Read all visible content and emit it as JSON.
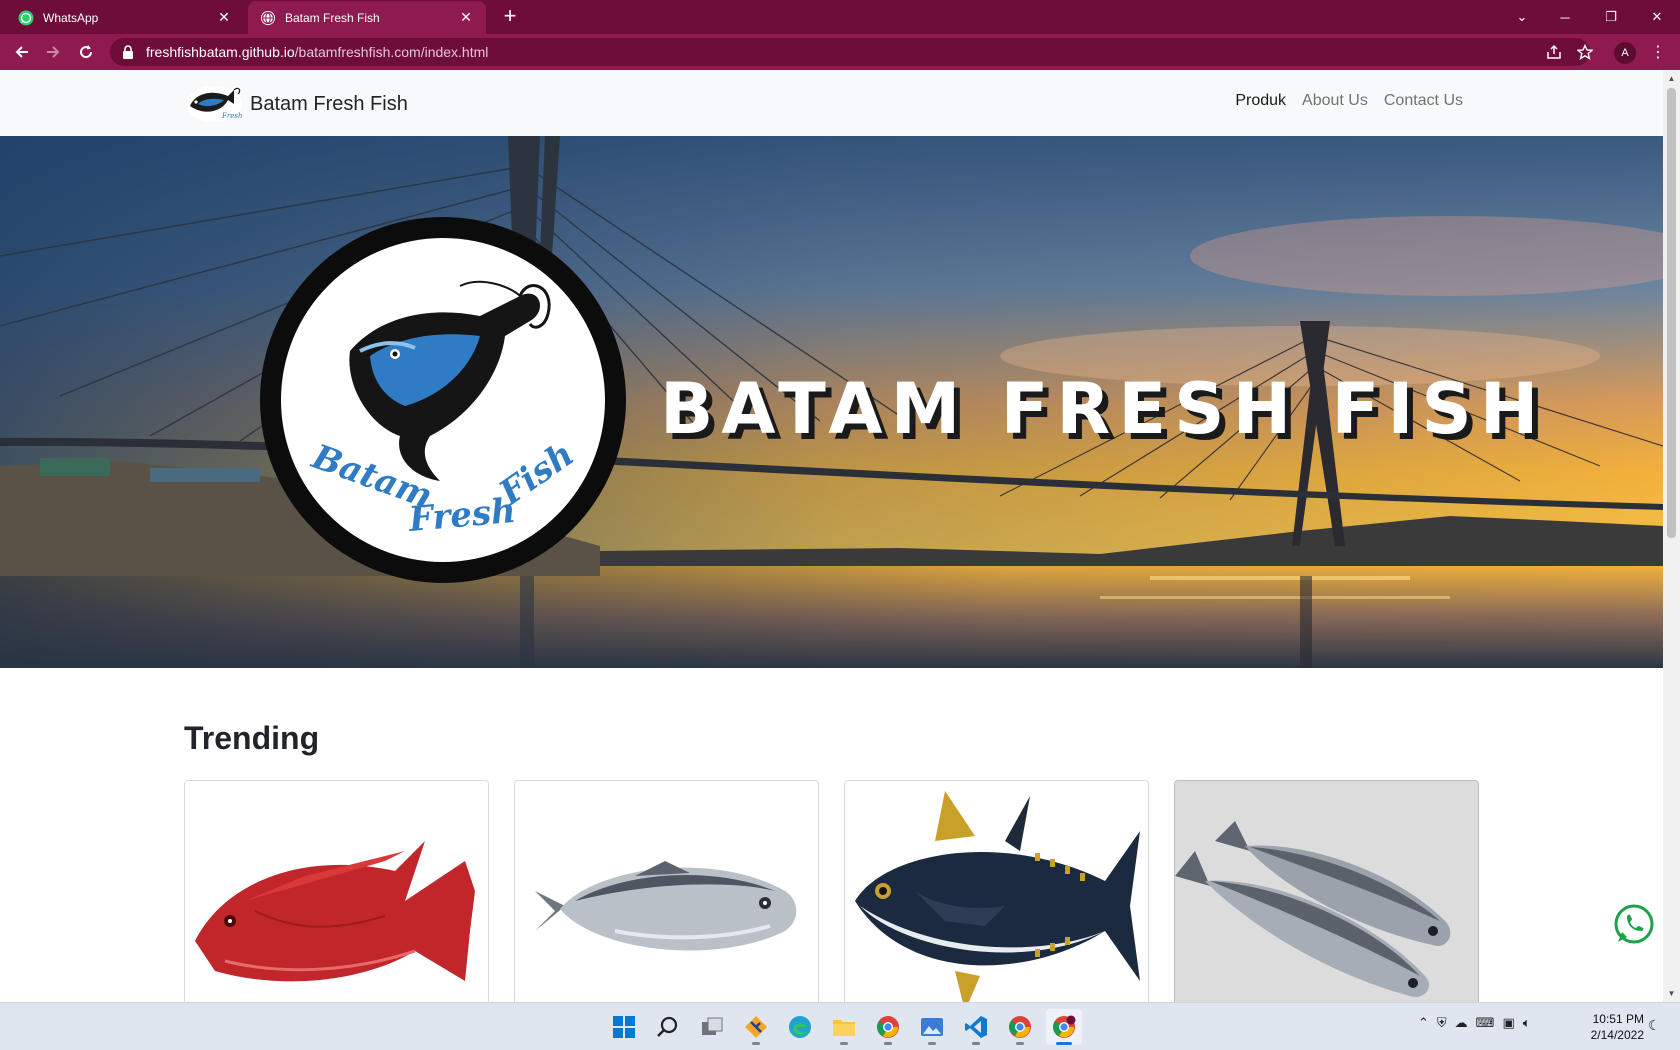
{
  "browser": {
    "tabs": [
      {
        "title": "WhatsApp",
        "active": false,
        "favicon": "whatsapp-icon"
      },
      {
        "title": "Batam Fresh Fish",
        "active": true,
        "favicon": "globe-icon"
      }
    ],
    "new_tab_symbol": "+",
    "url_domain": "freshfishbatam.github.io",
    "url_path": "/batamfreshfish.com/index.html",
    "profile_initial": "A",
    "colors": {
      "chrome_dark": "#6e0d3a",
      "chrome_light": "#8e1a50"
    }
  },
  "site": {
    "brand_name": "Batam Fresh Fish",
    "nav": [
      {
        "label": "Produk",
        "active": true
      },
      {
        "label": "About Us",
        "active": false
      },
      {
        "label": "Contact Us",
        "active": false
      }
    ],
    "hero_title": "BATAM FRESH FISH",
    "hero_logo_text": "Batam Fresh Fish",
    "section_title": "Trending",
    "products": [
      {
        "image": "red-snapper-image"
      },
      {
        "image": "bonito-fish-image"
      },
      {
        "image": "yellowfin-tuna-image"
      },
      {
        "image": "mackerel-pair-image"
      }
    ],
    "floating_button_icon": "whatsapp-icon"
  },
  "taskbar": {
    "apps": [
      "windows-start-icon",
      "search-icon",
      "task-view-icon",
      "git-icon",
      "edge-icon",
      "file-explorer-icon",
      "chrome-icon",
      "photos-icon",
      "vscode-icon",
      "chrome-icon",
      "chrome-profile-icon"
    ],
    "time": "10:51 PM",
    "date": "2/14/2022"
  }
}
